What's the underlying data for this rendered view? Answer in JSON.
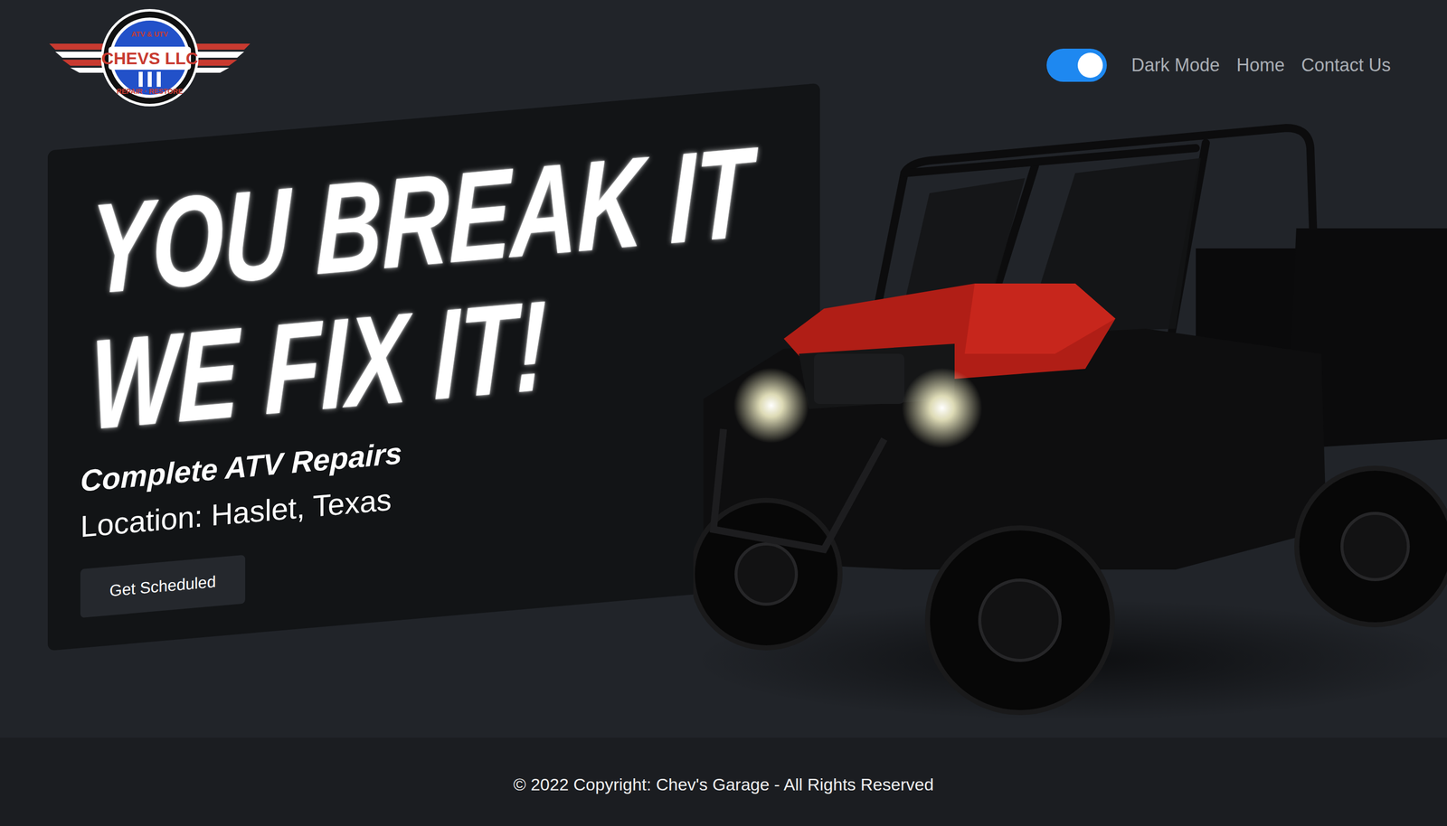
{
  "header": {
    "logo": {
      "top": "ATV & UTV",
      "name": "CHEVS LLC",
      "bottom": "REPAIR · RESTORE"
    },
    "dark_mode_toggle": {
      "on": true,
      "label": "Dark Mode"
    },
    "nav": [
      {
        "label": "Home"
      },
      {
        "label": "Contact Us"
      }
    ]
  },
  "hero": {
    "headline": [
      "YOU BREAK IT",
      "WE FIX IT!"
    ],
    "subtitle": "Complete ATV Repairs",
    "location": "Location: Haslet, Texas",
    "button": "Get Scheduled"
  },
  "footer": {
    "copyright": "© 2022 Copyright: Chev's Garage - All Rights Reserved"
  }
}
